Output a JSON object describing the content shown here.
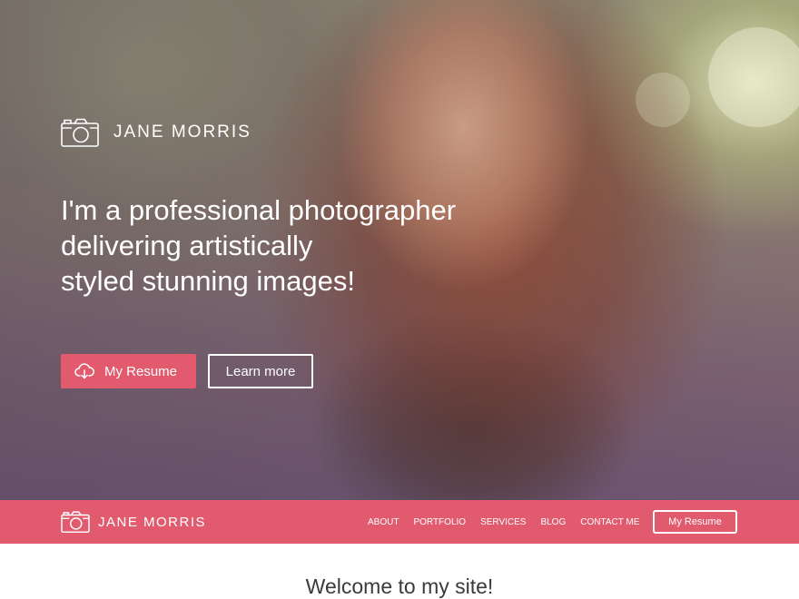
{
  "brand": {
    "name": "JANE MORRIS",
    "icon": "camera-icon"
  },
  "hero": {
    "headline_lines": [
      "I'm a professional photographer",
      "delivering artistically",
      "styled stunning images!"
    ],
    "primary_button": {
      "label": "My Resume",
      "icon": "cloud-download-icon"
    },
    "secondary_button": {
      "label": "Learn more"
    }
  },
  "nav": {
    "items": [
      {
        "label": "ABOUT"
      },
      {
        "label": "PORTFOLIO"
      },
      {
        "label": "SERVICES"
      },
      {
        "label": "BLOG"
      },
      {
        "label": "CONTACT ME"
      }
    ],
    "cta_label": "My Resume"
  },
  "welcome": {
    "title": "Welcome to my site!"
  },
  "colors": {
    "accent": "#e25a6d",
    "text_light": "#ffffff",
    "text_dark": "#3a3a3a"
  }
}
